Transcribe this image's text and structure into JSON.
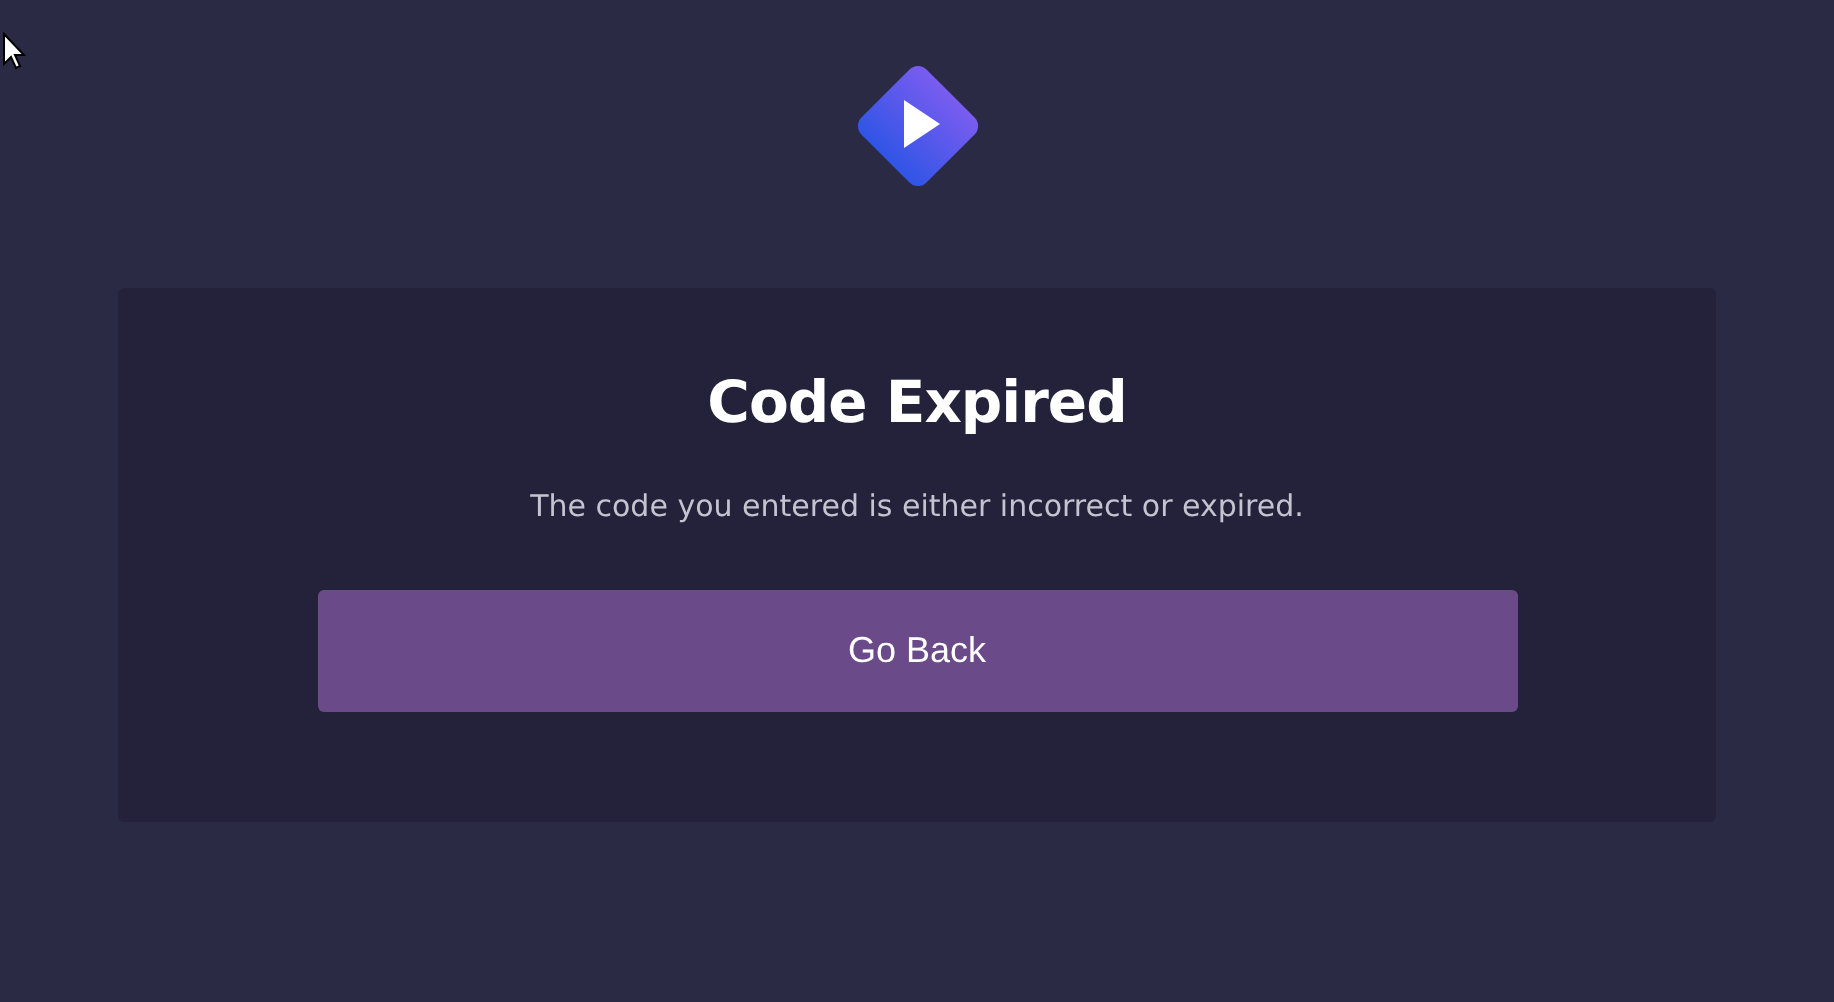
{
  "card": {
    "title": "Code Expired",
    "message": "The code you entered is either incorrect or expired.",
    "button": "Go Back"
  }
}
